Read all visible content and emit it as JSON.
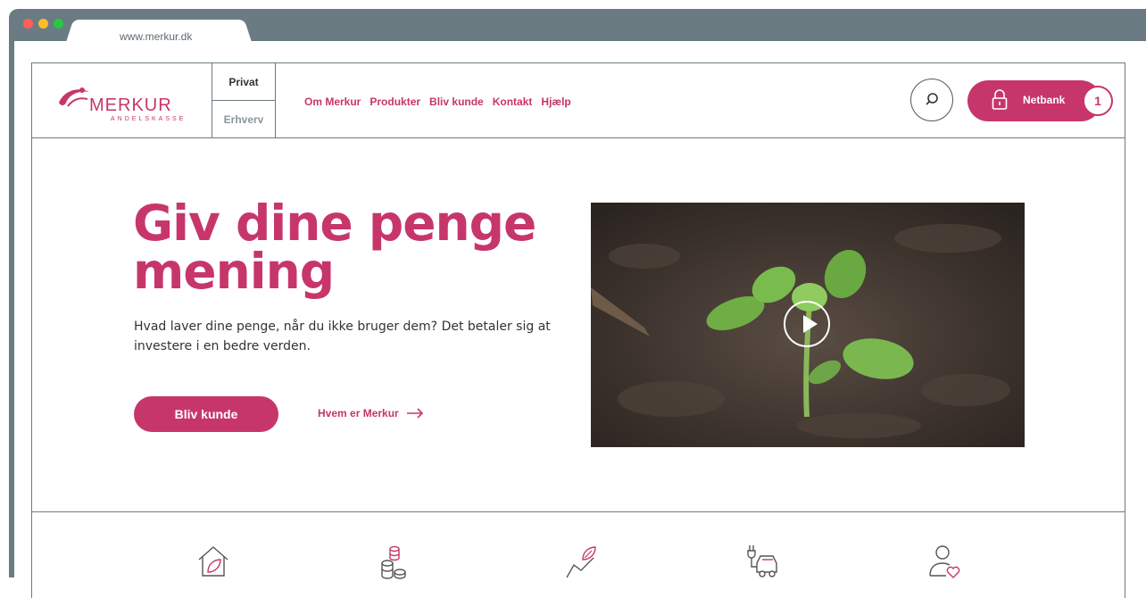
{
  "browser": {
    "url": "www.merkur.dk",
    "dots": [
      "#ff5f57",
      "#ffbd2e",
      "#28c840"
    ]
  },
  "header": {
    "logo": {
      "name": "MERKUR",
      "sub": "ANDELSKASSE"
    },
    "segments": {
      "privat": "Privat",
      "erhverv": "Erhverv"
    },
    "nav": [
      "Om Merkur",
      "Produkter",
      "Bliv kunde",
      "Kontakt",
      "Hjælp"
    ],
    "search_icon": "search-icon",
    "netbank_label": "Netbank",
    "badge": "1"
  },
  "hero": {
    "title": "Giv dine penge mening",
    "text": "Hvad laver dine penge, når du ikke bruger dem? Det betaler sig at investere i en bedre verden.",
    "cta": "Bliv kunde",
    "link": "Hvem er Merkur"
  },
  "colors": {
    "accent": "#c7366a",
    "frame": "#6b7b82"
  },
  "features": [
    "house-leaf-icon",
    "coins-icon",
    "growth-leaf-icon",
    "ev-car-icon",
    "person-heart-icon"
  ]
}
